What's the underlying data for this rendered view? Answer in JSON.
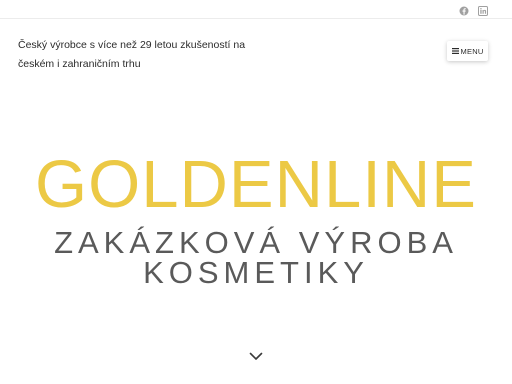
{
  "header": {
    "tagline_lines": [
      "Český výrobce s více než 29 letou zkušeností na",
      "českém i zahraničním trhu"
    ],
    "menu_label": "MENU",
    "social_icons": [
      "facebook-icon",
      "linkedin-icon"
    ]
  },
  "hero": {
    "brand": "GOLDENLINE",
    "subtitle_lines": [
      "ZAKÁZKOVÁ VÝROBA",
      "KOSMETIKY"
    ],
    "brand_color": "#ECC945",
    "subtitle_color": "#5A5A5A"
  },
  "scroll_icon": "chevron-down-icon"
}
